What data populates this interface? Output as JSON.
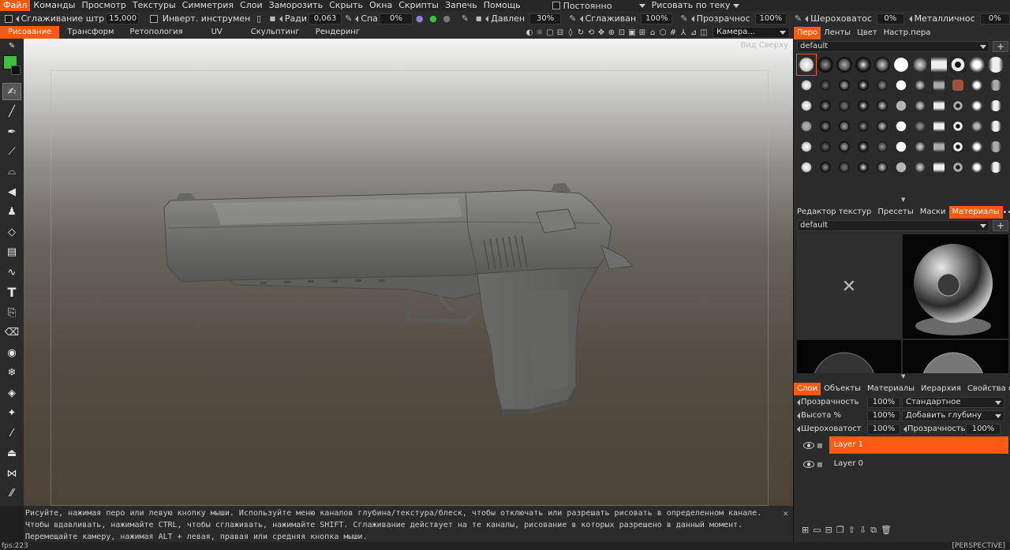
{
  "menu": {
    "items": [
      "Файл",
      "Команды",
      "Просмотр",
      "Текстуры",
      "Симметрия",
      "Слои",
      "Заморозить",
      "Скрыть",
      "Окна",
      "Скрипты",
      "Запечь",
      "Помощь"
    ],
    "mode_label": "Постоянно",
    "paint_mode_label": "Рисовать по теку"
  },
  "toolbar": {
    "smooth_label": "Сглаживание штр",
    "smooth_value": "15,000",
    "invert_label": "Инверт. инструмен",
    "radius_label": "Ради",
    "radius_value": "0,063",
    "falloff_label": "Спа",
    "falloff_value": "0%",
    "pressure_label": "Давлен",
    "pressure_value": "30%",
    "smoothing_label": "Сглаживан",
    "smoothing_value": "100%",
    "opacity_label": "Прозрачнос",
    "opacity_value": "100%",
    "roughness_label": "Шероховатос",
    "roughness_value": "0%",
    "metalness_label": "Металличнос",
    "metalness_value": "0%"
  },
  "rooms": {
    "items": [
      "Рисование",
      "Трансформ",
      "Ретопология",
      "UV",
      "Скульптинг",
      "Рендеринг"
    ],
    "camera_label": "Камера..."
  },
  "viewport": {
    "view_label": "Вид Сверху"
  },
  "hint": {
    "text": "Рисуйте, нажимая перо или левую кнопку мыши. Используйте меню каналов глубина/текстура/блеск, чтобы отключать или разрешать рисовать в определенном канале. Чтобы вдавливать, нажимайте CTRL, чтобы сглаживать, нажимайте SHIFT. Сглаживание действует на те каналы, рисование в которых разрешено в данный момент. Перемещайте камеру, нажимая ALT + левая, правая или средняя кнопка мыши."
  },
  "status": {
    "fps": "fps:223",
    "projection": "[PERSPECTIVE]"
  },
  "brush_panel": {
    "tabs": [
      "Перо",
      "Ленты",
      "Цвет",
      "Настр.пера"
    ],
    "preset": "default"
  },
  "materials_panel": {
    "tabs": [
      "Редактор текстур",
      "Пресеты",
      "Маски",
      "Материалы"
    ],
    "preset": "default"
  },
  "layers_panel": {
    "tabs": [
      "Слои",
      "Объекты",
      "Материалы",
      "Иерархия",
      "Свойства сл"
    ],
    "opacity_label": "Прозрачность",
    "opacity_value": "100%",
    "blend_mode": "Стандартное",
    "height_label": "Высота %",
    "height_value": "100%",
    "height_mode": "Добавить глубину",
    "roughness_label": "Шероховатост",
    "roughness_value": "100%",
    "opacity2_label": "Прозрачность",
    "opacity2_value": "100%",
    "layers": [
      "Layer 1",
      "Layer 0"
    ]
  },
  "colors": {
    "accent": "#ff5a12",
    "primary_color": "#3fbf3f"
  }
}
